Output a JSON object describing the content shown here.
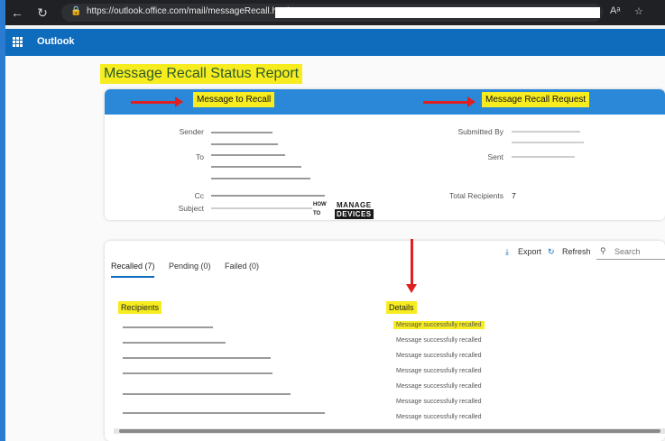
{
  "browser": {
    "back_icon": "back-arrow-icon",
    "refresh_icon": "refresh-icon",
    "url": "https://outlook.office.com/mail/messageRecall.html",
    "reader_icon": "read-aloud-icon",
    "favorite_icon": "star-icon"
  },
  "header": {
    "app_title": "Outlook"
  },
  "report": {
    "title": "Message Recall Status Report",
    "message_to_recall": "Message to Recall",
    "recall_request": "Message Recall Request",
    "labels": {
      "sender": "Sender",
      "to": "To",
      "cc": "Cc",
      "subject": "Subject",
      "submitted_by": "Submitted By",
      "sent": "Sent",
      "total_recipients": "Total Recipients"
    },
    "total_recipients": "7"
  },
  "tabs": [
    {
      "label": "Recalled (7)"
    },
    {
      "label": "Pending (0)"
    },
    {
      "label": "Failed (0)"
    }
  ],
  "toolbar": {
    "export": "Export",
    "refresh": "Refresh",
    "search_placeholder": "Search"
  },
  "table": {
    "col_recipients": "Recipients",
    "col_details": "Details",
    "rows": [
      "Message successfully recalled",
      "Message successfully recalled",
      "Message successfully recalled",
      "Message successfully recalled",
      "Message successfully recalled",
      "Message successfully recalled",
      "Message successfully recalled"
    ]
  },
  "logo": {
    "how": "HOW",
    "to": "TO",
    "manage": "MANAGE",
    "devices": "DEVICES"
  },
  "colors": {
    "highlight": "#f6ec1f",
    "arrow": "#e02020",
    "brand": "#0f6cbd"
  }
}
